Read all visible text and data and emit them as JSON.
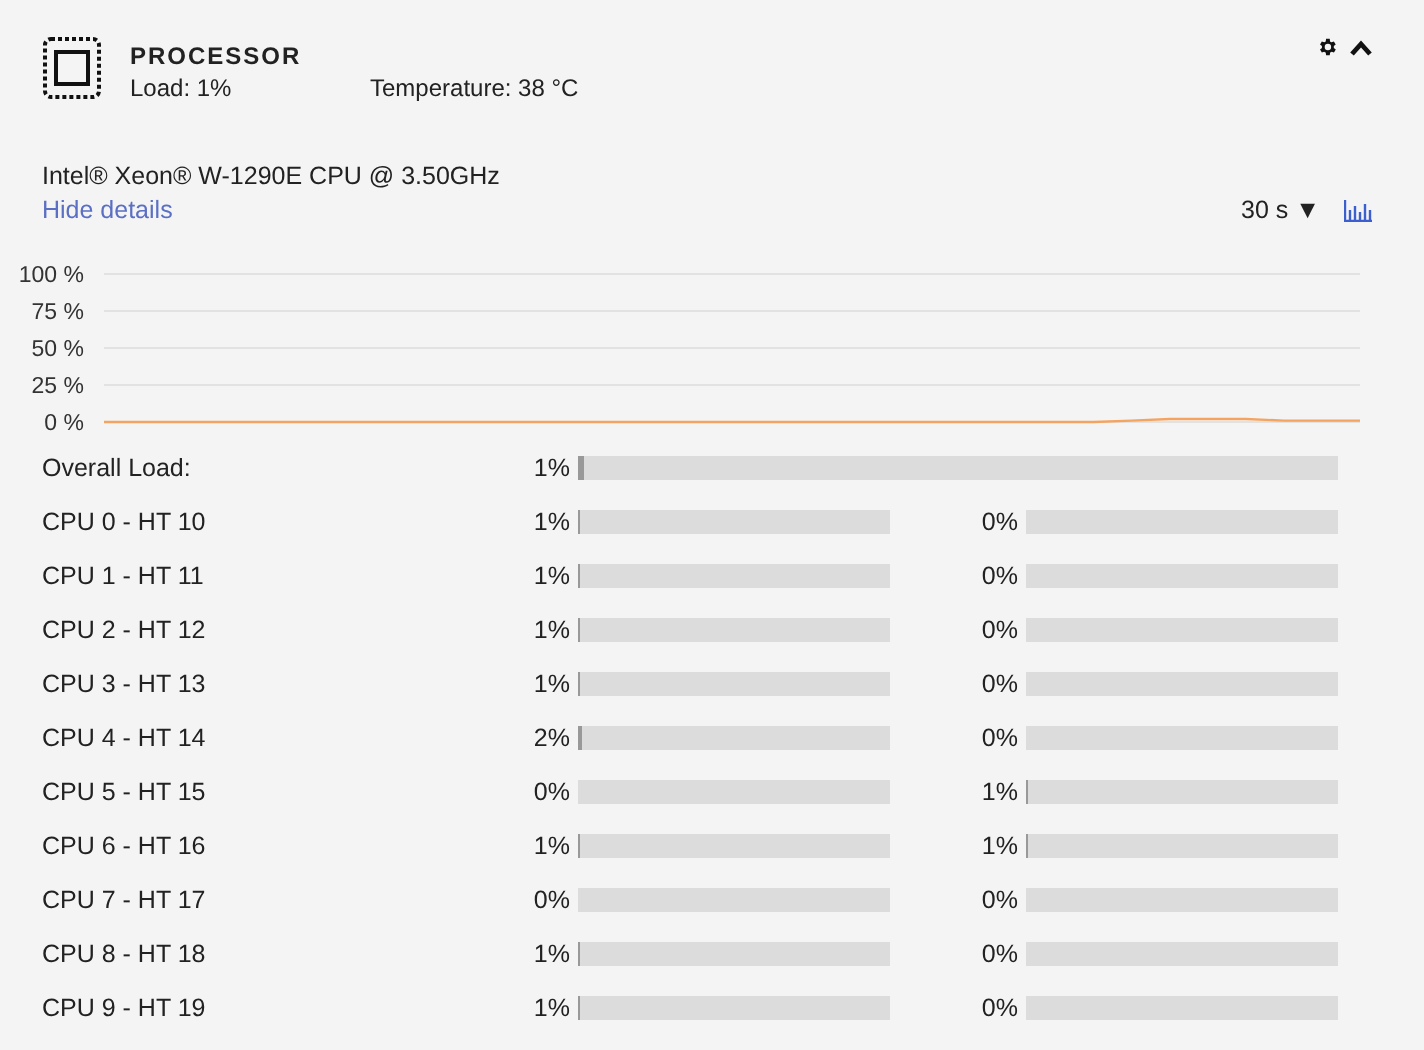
{
  "header": {
    "title": "PROCESSOR",
    "load": "Load: 1%",
    "temperature": "Temperature: 38 °C"
  },
  "cpu_name": "Intel® Xeon® W-1290E CPU @ 3.50GHz",
  "details_link": "Hide details",
  "interval": {
    "value": "30 s",
    "caret": "▼"
  },
  "chart": {
    "chart_data": {
      "type": "line",
      "grid": true,
      "ylim": [
        0,
        100
      ],
      "yticks": [
        {
          "value": 0,
          "label": "0 %"
        },
        {
          "value": 25,
          "label": "25 %"
        },
        {
          "value": 50,
          "label": "50 %"
        },
        {
          "value": 75,
          "label": "75 %"
        },
        {
          "value": 100,
          "label": "100 %"
        }
      ],
      "series": [
        {
          "color": "#f4a460",
          "values": [
            0,
            0,
            0,
            0,
            0,
            0,
            0,
            0,
            0,
            0,
            0,
            0,
            0,
            0,
            0,
            0,
            0,
            0,
            0,
            0,
            0,
            0,
            0,
            0,
            0,
            0,
            0,
            1,
            2,
            2,
            2,
            1,
            1,
            1
          ]
        }
      ]
    }
  },
  "overall": {
    "label": "Overall Load:",
    "reading": "1%",
    "level": 0.01
  },
  "cores": [
    {
      "label": "CPU 0 - HT 10",
      "a": {
        "reading": "1%",
        "level": 0.01
      },
      "b": {
        "reading": "0%",
        "level": 0
      }
    },
    {
      "label": "CPU 1 - HT 11",
      "a": {
        "reading": "1%",
        "level": 0.01
      },
      "b": {
        "reading": "0%",
        "level": 0
      }
    },
    {
      "label": "CPU 2 - HT 12",
      "a": {
        "reading": "1%",
        "level": 0.01
      },
      "b": {
        "reading": "0%",
        "level": 0
      }
    },
    {
      "label": "CPU 3 - HT 13",
      "a": {
        "reading": "1%",
        "level": 0.01
      },
      "b": {
        "reading": "0%",
        "level": 0
      }
    },
    {
      "label": "CPU 4 - HT 14",
      "a": {
        "reading": "2%",
        "level": 0.02
      },
      "b": {
        "reading": "0%",
        "level": 0
      }
    },
    {
      "label": "CPU 5 - HT 15",
      "a": {
        "reading": "0%",
        "level": 0
      },
      "b": {
        "reading": "1%",
        "level": 0.01
      }
    },
    {
      "label": "CPU 6 - HT 16",
      "a": {
        "reading": "1%",
        "level": 0.01
      },
      "b": {
        "reading": "1%",
        "level": 0.01
      }
    },
    {
      "label": "CPU 7 - HT 17",
      "a": {
        "reading": "0%",
        "level": 0
      },
      "b": {
        "reading": "0%",
        "level": 0
      }
    },
    {
      "label": "CPU 8 - HT 18",
      "a": {
        "reading": "1%",
        "level": 0.01
      },
      "b": {
        "reading": "0%",
        "level": 0
      }
    },
    {
      "label": "CPU 9 - HT 19",
      "a": {
        "reading": "1%",
        "level": 0.01
      },
      "b": {
        "reading": "0%",
        "level": 0
      }
    }
  ]
}
